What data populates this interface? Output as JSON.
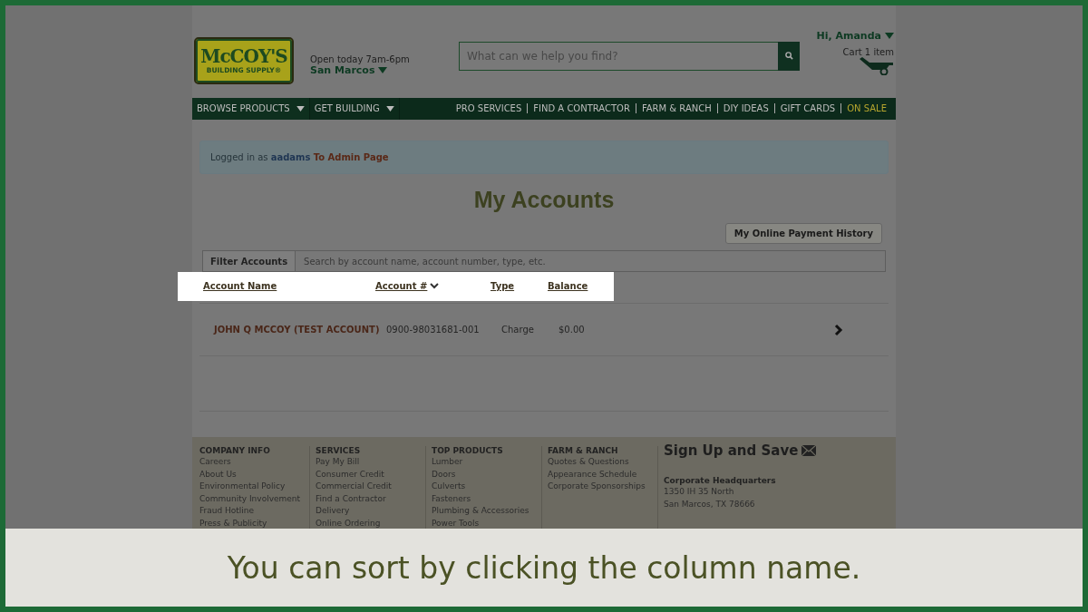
{
  "header": {
    "logo_top": "McCOY'S",
    "logo_bottom": "BUILDING SUPPLY®",
    "store_hours": "Open today 7am-6pm",
    "store_location": "San Marcos",
    "search": {
      "placeholder": "What can we help you find?"
    },
    "greeting": "Hi, Amanda",
    "cart": "Cart 1 item"
  },
  "nav_left": [
    {
      "label": "BROWSE PRODUCTS"
    },
    {
      "label": "GET BUILDING"
    }
  ],
  "nav_right": [
    {
      "label": "PRO SERVICES",
      "highlight": false
    },
    {
      "label": "FIND A CONTRACTOR",
      "highlight": false
    },
    {
      "label": "FARM & RANCH",
      "highlight": false
    },
    {
      "label": "DIY IDEAS",
      "highlight": false
    },
    {
      "label": "GIFT CARDS",
      "highlight": false
    },
    {
      "label": "ON SALE",
      "highlight": true
    }
  ],
  "alert": {
    "prefix": "Logged in as",
    "username": "aadams",
    "link": "To Admin Page"
  },
  "title": "My Accounts",
  "payment_history_button": "My Online Payment History",
  "filter": {
    "label": "Filter Accounts",
    "placeholder": "Search by account name, account number, type, etc."
  },
  "columns": [
    {
      "label": "Account Name",
      "sorted": false
    },
    {
      "label": "Account #",
      "sorted": true
    },
    {
      "label": "Type",
      "sorted": false
    },
    {
      "label": "Balance",
      "sorted": false
    }
  ],
  "rows": [
    {
      "account_name": "JOHN Q MCCOY (TEST ACCOUNT)",
      "account_number": "0900-98031681-001",
      "type": "Charge",
      "balance": "$0.00"
    }
  ],
  "footer": [
    {
      "heading": "COMPANY INFO",
      "links": [
        "Careers",
        "About Us",
        "Environmental Policy",
        "Community Involvement",
        "Fraud Hotline",
        "Press & Publicity"
      ]
    },
    {
      "heading": "SERVICES",
      "links": [
        "Pay My Bill",
        "Consumer Credit",
        "Commercial Credit",
        "Find a Contractor",
        "Delivery",
        "Online Ordering"
      ]
    },
    {
      "heading": "TOP PRODUCTS",
      "links": [
        "Lumber",
        "Doors",
        "Culverts",
        "Fasteners",
        "Plumbing & Accessories",
        "Power Tools"
      ]
    },
    {
      "heading": "FARM & RANCH",
      "links": [
        "Quotes & Questions",
        "Appearance Schedule",
        "Corporate Sponsorships"
      ]
    }
  ],
  "signup": "Sign Up and Save",
  "headquarters": {
    "heading": "Corporate Headquarters",
    "lines": [
      "1350 IH 35 North",
      "San Marcos, TX 78666"
    ]
  },
  "caption": "You can sort by clicking the column name."
}
